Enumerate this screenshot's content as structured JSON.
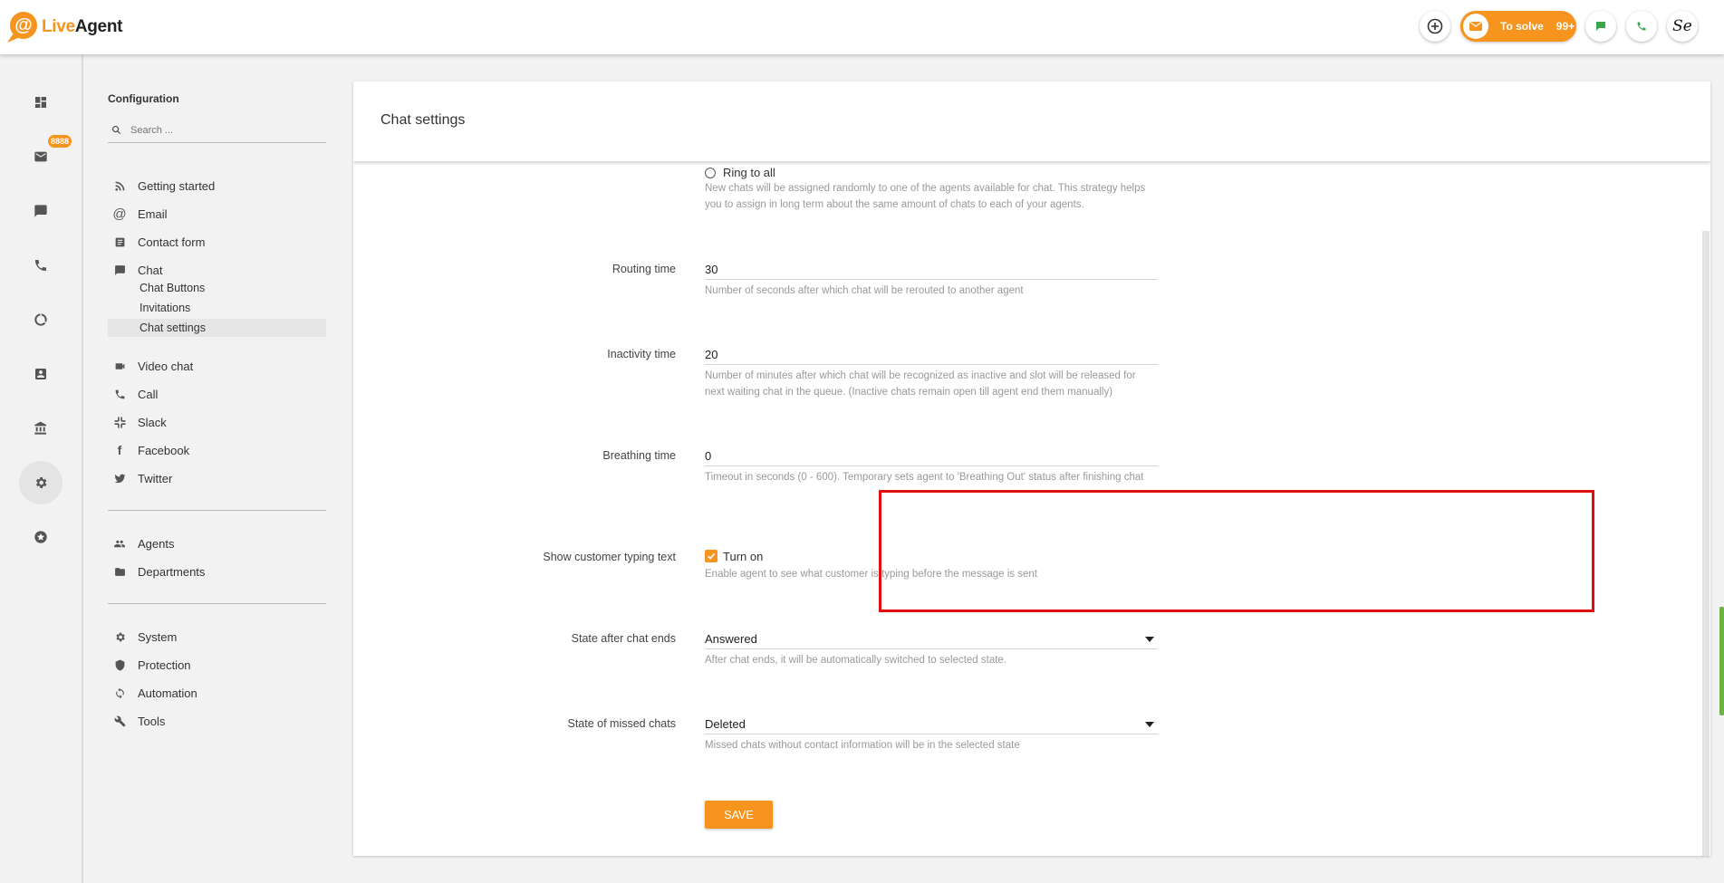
{
  "app": {
    "logo_live": "Live",
    "logo_agent": "Agent"
  },
  "topbar": {
    "tosolve_label": "To solve",
    "tosolve_count": "99+",
    "avatar_text": "Se",
    "colors": {
      "accent": "#f7941d",
      "chat_green": "#3aa64a"
    }
  },
  "rail": {
    "items": [
      {
        "icon": "dashboard-icon"
      },
      {
        "icon": "tickets-icon",
        "badge": "8888"
      },
      {
        "icon": "chat-icon"
      },
      {
        "icon": "calls-icon"
      },
      {
        "icon": "reports-icon"
      },
      {
        "icon": "contacts-icon"
      },
      {
        "icon": "knowledgebase-icon"
      },
      {
        "icon": "configuration-icon",
        "active": true
      },
      {
        "icon": "plugins-icon"
      }
    ]
  },
  "sidebar": {
    "title": "Configuration",
    "search_placeholder": "Search ...",
    "items": [
      {
        "label": "Getting started",
        "icon": "rss-icon"
      },
      {
        "label": "Email",
        "icon": "at-icon"
      },
      {
        "label": "Contact form",
        "icon": "form-icon"
      },
      {
        "label": "Chat",
        "icon": "chat-icon"
      },
      {
        "label": "Video chat",
        "icon": "video-icon"
      },
      {
        "label": "Call",
        "icon": "phone-icon"
      },
      {
        "label": "Slack",
        "icon": "slack-icon"
      },
      {
        "label": "Facebook",
        "icon": "facebook-icon"
      },
      {
        "label": "Twitter",
        "icon": "twitter-icon"
      },
      {
        "label": "Agents",
        "icon": "people-icon"
      },
      {
        "label": "Departments",
        "icon": "folder-icon"
      },
      {
        "label": "System",
        "icon": "gear-icon"
      },
      {
        "label": "Protection",
        "icon": "shield-icon"
      },
      {
        "label": "Automation",
        "icon": "sync-icon"
      },
      {
        "label": "Tools",
        "icon": "wrench-icon"
      }
    ],
    "chat_sub": [
      "Chat Buttons",
      "Invitations",
      "Chat settings"
    ]
  },
  "main": {
    "title": "Chat settings",
    "ring_to_all": "Ring to all",
    "ring_help": "New chats will be assigned randomly to one of the agents available for chat. This strategy helps you to assign in long term about the same amount of chats to each of your agents.",
    "fields": {
      "routing_time": {
        "label": "Routing time",
        "value": "30",
        "help": "Number of seconds after which chat will be rerouted to another agent"
      },
      "inactivity_time": {
        "label": "Inactivity time",
        "value": "20",
        "help": "Number of minutes after which chat will be recognized as inactive and slot will be released for next waiting chat in the queue. (Inactive chats remain open till agent end them manually)"
      },
      "breathing_time": {
        "label": "Breathing time",
        "value": "0",
        "help": "Timeout in seconds (0 - 600). Temporary sets agent to 'Breathing Out' status after finishing chat"
      },
      "typing_text": {
        "label": "Show customer typing text",
        "option": "Turn on",
        "checked": true,
        "help": "Enable agent to see what customer is typing before the message is sent"
      },
      "state_after": {
        "label": "State after chat ends",
        "value": "Answered",
        "help": "After chat ends, it will be automatically switched to selected state."
      },
      "state_missed": {
        "label": "State of missed chats",
        "value": "Deleted",
        "help": "Missed chats without contact information will be in the selected state"
      }
    },
    "save_label": "SAVE"
  }
}
